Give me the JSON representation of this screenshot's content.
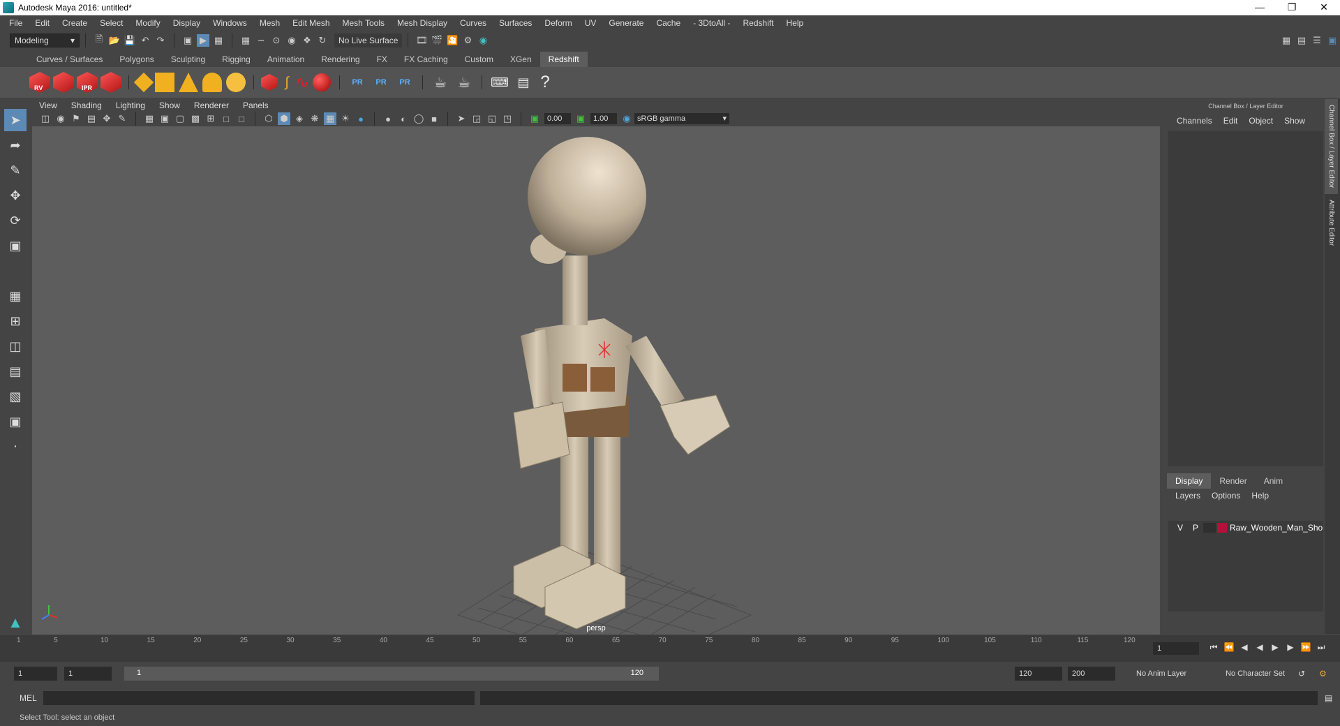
{
  "window": {
    "title": "Autodesk Maya 2016: untitled*"
  },
  "menubar": [
    "File",
    "Edit",
    "Create",
    "Select",
    "Modify",
    "Display",
    "Windows",
    "Mesh",
    "Edit Mesh",
    "Mesh Tools",
    "Mesh Display",
    "Curves",
    "Surfaces",
    "Deform",
    "UV",
    "Generate",
    "Cache",
    "- 3DtoAll -",
    "Redshift",
    "Help"
  ],
  "statusline": {
    "mode": "Modeling",
    "live_surface": "No Live Surface"
  },
  "shelf_tabs": [
    "Curves / Surfaces",
    "Polygons",
    "Sculpting",
    "Rigging",
    "Animation",
    "Rendering",
    "FX",
    "FX Caching",
    "Custom",
    "XGen",
    "Redshift"
  ],
  "shelf_active_tab": "Redshift",
  "shelf_icons": [
    {
      "name": "redshift-rv-icon",
      "tag": "RV"
    },
    {
      "name": "redshift-render-icon",
      "tag": ""
    },
    {
      "name": "redshift-ipr-icon",
      "tag": "IPR"
    },
    {
      "name": "redshift-settings-icon",
      "tag": ""
    }
  ],
  "shelf_pr_labels": [
    "PR",
    "PR",
    "PR"
  ],
  "viewport": {
    "menus": [
      "View",
      "Shading",
      "Lighting",
      "Show",
      "Renderer",
      "Panels"
    ],
    "exposure": "0.00",
    "gamma_value": "1.00",
    "color_space": "sRGB gamma",
    "camera_label": "persp",
    "accent": "#5d8ab5"
  },
  "channel_box": {
    "header": "Channel Box / Layer Editor",
    "menus": [
      "Channels",
      "Edit",
      "Object",
      "Show"
    ],
    "tabs": [
      "Display",
      "Render",
      "Anim"
    ],
    "layer_menus": [
      "Layers",
      "Options",
      "Help"
    ],
    "layer": {
      "v": "V",
      "p": "P",
      "name": "Raw_Wooden_Man_Sho",
      "color": "#b0123a"
    }
  },
  "side_tabs": [
    "Channel Box / Layer Editor",
    "Attribute Editor"
  ],
  "timeline": {
    "ticks": [
      "1",
      "5",
      "10",
      "15",
      "20",
      "25",
      "30",
      "35",
      "40",
      "45",
      "50",
      "55",
      "60",
      "65",
      "70",
      "75",
      "80",
      "85",
      "90",
      "95",
      "100",
      "105",
      "110",
      "115",
      "120"
    ],
    "current_frame": "1"
  },
  "range": {
    "start": "1",
    "playback_start": "1",
    "slider_start": "1",
    "slider_end": "120",
    "playback_end": "120",
    "end": "200",
    "anim_layer": "No Anim Layer",
    "character_set": "No Character Set"
  },
  "command": {
    "label": "MEL"
  },
  "help_line": "Select Tool: select an object"
}
